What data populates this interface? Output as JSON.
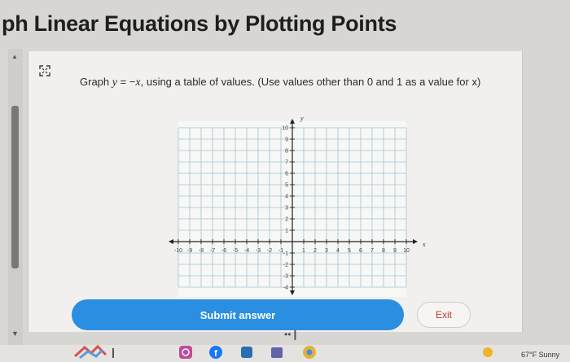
{
  "page": {
    "title": "ph Linear Equations by Plotting Points"
  },
  "question": {
    "prefix": "Graph ",
    "equation_lhs": "y",
    "equation_mid": " = −",
    "equation_rhs": "x",
    "suffix": ", using a table of values. (Use values other than 0 and 1 as a value for x)"
  },
  "graph": {
    "x_axis_label": "x",
    "y_axis_label": "y",
    "x_ticks": [
      "-10",
      "-9",
      "-8",
      "-7",
      "-6",
      "-5",
      "-4",
      "-3",
      "-2",
      "-1",
      "1",
      "2",
      "3",
      "4",
      "5",
      "6",
      "7",
      "8",
      "9",
      "10"
    ],
    "y_ticks_positive": [
      "10",
      "9",
      "8",
      "7",
      "6",
      "5",
      "4",
      "3",
      "2",
      "1"
    ],
    "y_ticks_negative": [
      "-1",
      "-2",
      "-3",
      "-4"
    ]
  },
  "buttons": {
    "submit_label": "Submit answer",
    "exit_label": "Exit"
  },
  "taskbar": {
    "weather": "67°F  Sunny"
  },
  "colors": {
    "submit": "#2a8fe0",
    "exit_text": "#c0392b",
    "grid_line": "#9fc3d6"
  },
  "edge_mark": "h"
}
